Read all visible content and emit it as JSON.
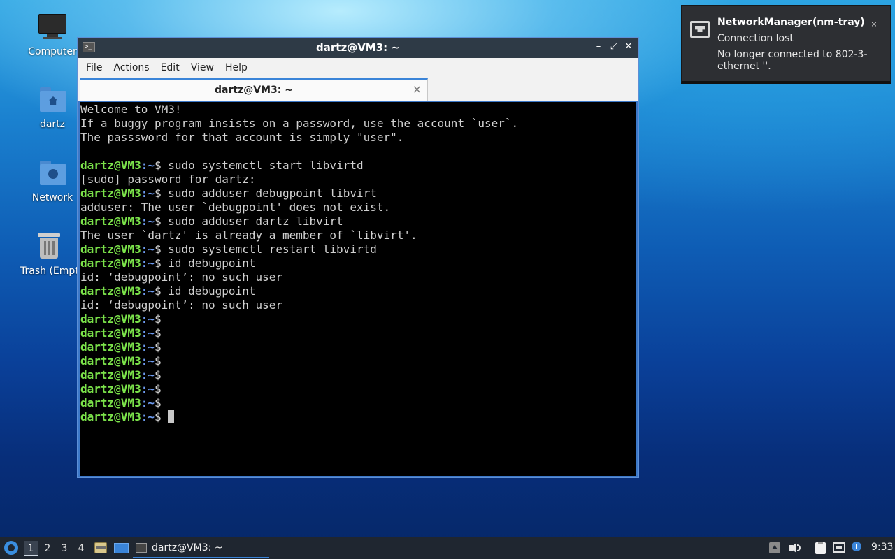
{
  "desktop": {
    "icons": [
      {
        "label": "Computer"
      },
      {
        "label": "dartz"
      },
      {
        "label": "Network"
      },
      {
        "label": "Trash (Empt"
      }
    ]
  },
  "window": {
    "title": "dartz@VM3: ~",
    "menu": [
      "File",
      "Actions",
      "Edit",
      "View",
      "Help"
    ],
    "tab_label": "dartz@VM3: ~",
    "tab_close": "×",
    "prompt_user": "dartz@VM3",
    "prompt_path": ":~",
    "terminal_lines": [
      {
        "type": "out",
        "text": "Welcome to VM3!"
      },
      {
        "type": "out",
        "text": "If a buggy program insists on a password, use the account `user`."
      },
      {
        "type": "out",
        "text": "The passsword for that account is simply \"user\"."
      },
      {
        "type": "out",
        "text": ""
      },
      {
        "type": "cmd",
        "text": "$ sudo systemctl start libvirtd"
      },
      {
        "type": "out",
        "text": "[sudo] password for dartz:"
      },
      {
        "type": "cmd",
        "text": "$ sudo adduser debugpoint libvirt"
      },
      {
        "type": "out",
        "text": "adduser: The user `debugpoint' does not exist."
      },
      {
        "type": "cmd",
        "text": "$ sudo adduser dartz libvirt"
      },
      {
        "type": "out",
        "text": "The user `dartz' is already a member of `libvirt'."
      },
      {
        "type": "cmd",
        "text": "$ sudo systemctl restart libvirtd"
      },
      {
        "type": "cmd",
        "text": "$ id debugpoint"
      },
      {
        "type": "out",
        "text": "id: ‘debugpoint’: no such user"
      },
      {
        "type": "cmd",
        "text": "$ id debugpoint"
      },
      {
        "type": "out",
        "text": "id: ‘debugpoint’: no such user"
      },
      {
        "type": "cmd",
        "text": "$"
      },
      {
        "type": "cmd",
        "text": "$"
      },
      {
        "type": "cmd",
        "text": "$"
      },
      {
        "type": "cmd",
        "text": "$"
      },
      {
        "type": "cmd",
        "text": "$"
      },
      {
        "type": "cmd",
        "text": "$"
      },
      {
        "type": "cmd",
        "text": "$"
      },
      {
        "type": "cur",
        "text": "$ "
      }
    ]
  },
  "notification": {
    "app": "NetworkManager(nm-tray)",
    "summary": "Connection lost",
    "body": "No longer connected to 802-3-ethernet ''.",
    "close": "×"
  },
  "taskbar": {
    "workspaces": [
      "1",
      "2",
      "3",
      "4"
    ],
    "active_workspace": "1",
    "task_label": "dartz@VM3: ~",
    "clock": "9:33"
  },
  "colors": {
    "prompt_user": "#7be24a",
    "prompt_path": "#6e9cf0",
    "window_accent": "#3a84d8"
  }
}
